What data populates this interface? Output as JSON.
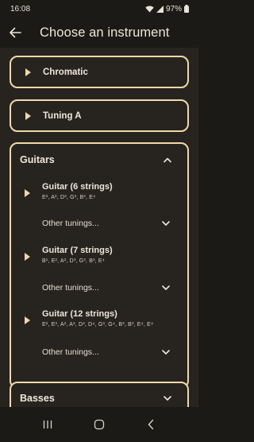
{
  "status_bar": {
    "time": "16:08",
    "battery": "97%",
    "icons": [
      "wifi-icon",
      "signal-icon",
      "battery-icon"
    ]
  },
  "app_bar": {
    "title": "Choose an instrument",
    "back_icon": "arrow-left-icon"
  },
  "instruments": [
    {
      "label": "Chromatic"
    },
    {
      "label": "Tuning A"
    }
  ],
  "groups": [
    {
      "title": "Guitars",
      "expanded": true,
      "items": [
        {
          "name": "Guitar (6 strings)",
          "notes": "E², A², D³, G³, B³, E⁴",
          "other": "Other tunings..."
        },
        {
          "name": "Guitar (7 strings)",
          "notes": "B¹, E², A², D³, G³, B³, E⁴",
          "other": "Other tunings..."
        },
        {
          "name": "Guitar (12 strings)",
          "notes": "E², E³, A², A³, D³, D⁴, G³, G⁴, B³, B³, E⁴, E⁴",
          "other": "Other tunings..."
        }
      ]
    },
    {
      "title": "Basses",
      "expanded": false
    }
  ],
  "colors": {
    "accent": "#f0d9a8",
    "background": "#272420",
    "bar": "#1c1a17",
    "text": "#ede6da"
  },
  "nav_bar": {
    "icons": [
      "recent-apps-icon",
      "home-icon",
      "back-icon"
    ]
  }
}
